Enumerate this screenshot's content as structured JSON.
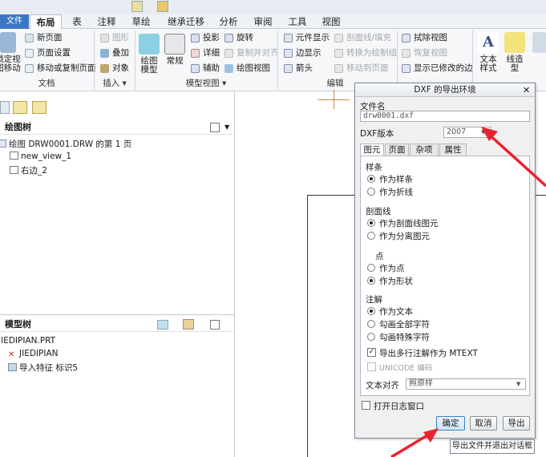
{
  "tabs": [
    "文件",
    "布局",
    "表",
    "注释",
    "草绘",
    "继承迁移",
    "分析",
    "审阅",
    "工具",
    "视图"
  ],
  "ribbon": {
    "big": [
      "绘图模型",
      "常规",
      "文本样式",
      "线造型"
    ],
    "doc": [
      "新页面",
      "页面设置",
      "移动或复制页面"
    ],
    "big_left": "锁定视图移动",
    "insert": [
      "图形",
      "叠加",
      "对象"
    ],
    "model": [
      "投影",
      "旋转",
      "详细",
      "复制并对齐",
      "辅助",
      "绘图视图"
    ],
    "edit": [
      "元件显示",
      "边显示",
      "箭头"
    ],
    "edit2": [
      "剖面线/填充",
      "转换为绘制组",
      "移动到页面"
    ],
    "edit3": [
      "拭除视图",
      "恢复视图",
      "显示已修改的边"
    ],
    "groups": [
      "文档",
      "插入 ▾",
      "模型视图 ▾",
      "编辑"
    ]
  },
  "draw_tree": {
    "title": "绘图树",
    "items": [
      "绘图 DRW0001.DRW 的第 1 页",
      "new_view_1",
      "右边_2"
    ]
  },
  "model_tree": {
    "title": "模型树",
    "items": [
      "JIEDIPIAN.PRT",
      "JIEDIPIAN",
      "导入特征 标识5"
    ]
  },
  "dialog": {
    "title": "DXF 的导出环境",
    "filename_label": "文件名",
    "filename": "drw0001.dxf",
    "version_label": "DXF版本",
    "version": "2007",
    "tabs": [
      "图元",
      "页面",
      "杂项",
      "属性"
    ],
    "spline": {
      "label": "样条",
      "opts": [
        "作为样条",
        "作为折线"
      ]
    },
    "hatch": {
      "label": "剖面线",
      "opts": [
        "作为剖面线图元",
        "作为分离图元"
      ]
    },
    "point": {
      "label": "点",
      "opts": [
        "作为点",
        "作为形状"
      ]
    },
    "note": {
      "label": "注解",
      "opts": [
        "作为文本",
        "勾画全部字符",
        "勾画特殊字符"
      ]
    },
    "mtext": "导出多行注解作为 MTEXT",
    "unicode": "UNICODE 编码",
    "align_label": "文本对齐",
    "align": "照原样",
    "log": "打开日志窗口",
    "ok": "确定",
    "cancel": "取消",
    "export": "导出"
  },
  "tooltip": "导出文件并退出对话框",
  "colors": {
    "accent": "#3a76c5",
    "arrow": "#e8232f"
  }
}
